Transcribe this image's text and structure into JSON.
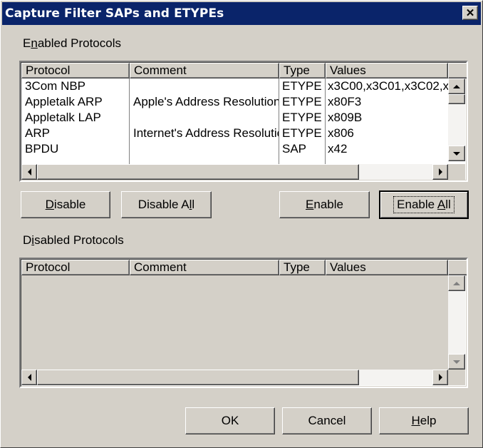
{
  "window": {
    "title": "Capture Filter SAPs and ETYPEs",
    "close_glyph": "✕"
  },
  "enabled": {
    "group_label_pre": "E",
    "group_label_u": "n",
    "group_label_post": "abled Protocols",
    "columns": [
      "Protocol",
      "Comment",
      "Type",
      "Values"
    ],
    "rows": [
      {
        "protocol": "3Com NBP",
        "comment": "",
        "type": "ETYPE",
        "values": "x3C00,x3C01,x3C02,x"
      },
      {
        "protocol": "Appletalk ARP",
        "comment": "Apple's Address Resolution",
        "type": "ETYPE",
        "values": "x80F3"
      },
      {
        "protocol": "Appletalk LAP",
        "comment": "",
        "type": "ETYPE",
        "values": "x809B"
      },
      {
        "protocol": "ARP",
        "comment": "Internet's Address Resolution",
        "type": "ETYPE",
        "values": "x806"
      },
      {
        "protocol": "BPDU",
        "comment": "",
        "type": "SAP",
        "values": "x42"
      }
    ]
  },
  "disabled": {
    "group_label_pre": "D",
    "group_label_u": "i",
    "group_label_post": "sabled Protocols",
    "columns": [
      "Protocol",
      "Comment",
      "Type",
      "Values"
    ],
    "rows": []
  },
  "buttons": {
    "disable": {
      "u": "D",
      "rest": "isable"
    },
    "disable_all": {
      "pre": "Disable A",
      "u": "l",
      "post": "l"
    },
    "enable": {
      "u": "E",
      "rest": "nable"
    },
    "enable_all": {
      "pre": "Enable ",
      "u": "A",
      "post": "ll"
    },
    "ok": "OK",
    "cancel": "Cancel",
    "help": {
      "u": "H",
      "rest": "elp"
    }
  }
}
